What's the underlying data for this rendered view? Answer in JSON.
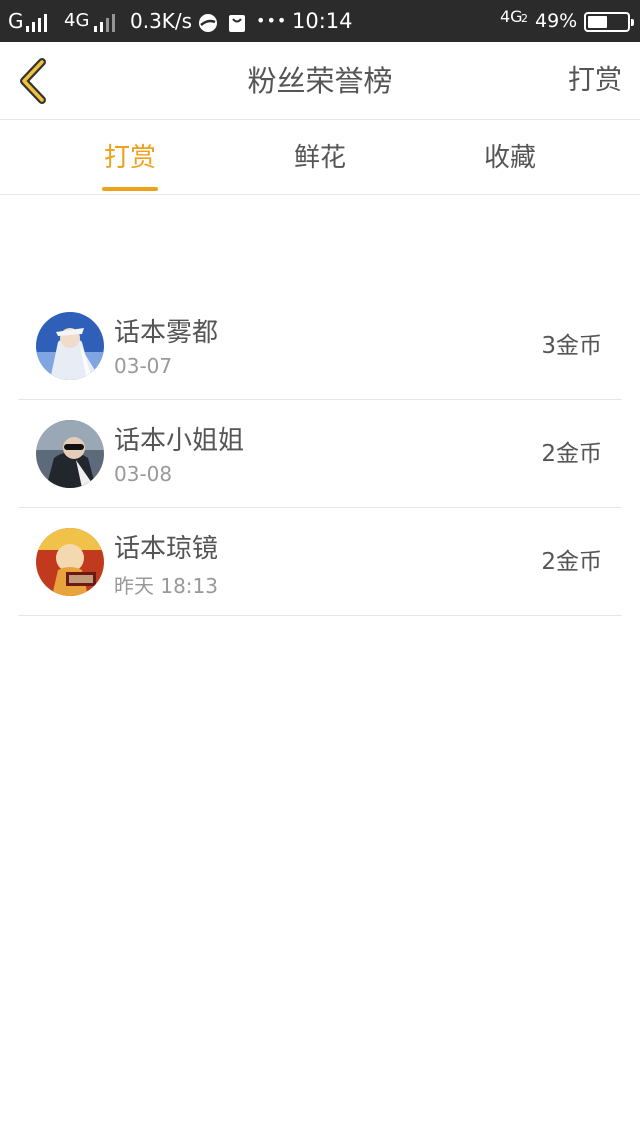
{
  "status_bar": {
    "carrier1": "G",
    "carrier2": "4G",
    "speed": "0.3K/s",
    "dots": "•••",
    "time": "10:14",
    "network": "4G",
    "sim": "2",
    "battery_percent": "49%",
    "battery_level": 0.49,
    "icons": [
      "signal-icon",
      "signal-icon",
      "browser-icon",
      "bag-icon",
      "battery-icon"
    ]
  },
  "nav": {
    "title": "粉丝荣誉榜",
    "back_icon": "chevron-left-icon",
    "action_label": "打赏",
    "accent_color": "#f0a11a"
  },
  "tabs": [
    {
      "label": "打赏",
      "active": true
    },
    {
      "label": "鲜花",
      "active": false
    },
    {
      "label": "收藏",
      "active": false
    }
  ],
  "fans": [
    {
      "name": "话本雾都",
      "date": "03-07",
      "amount": "3金币"
    },
    {
      "name": "话本小姐姐",
      "date": "03-08",
      "amount": "2金币"
    },
    {
      "name": "话本琼镜",
      "date": "昨天 18:13",
      "amount": "2金币"
    }
  ]
}
